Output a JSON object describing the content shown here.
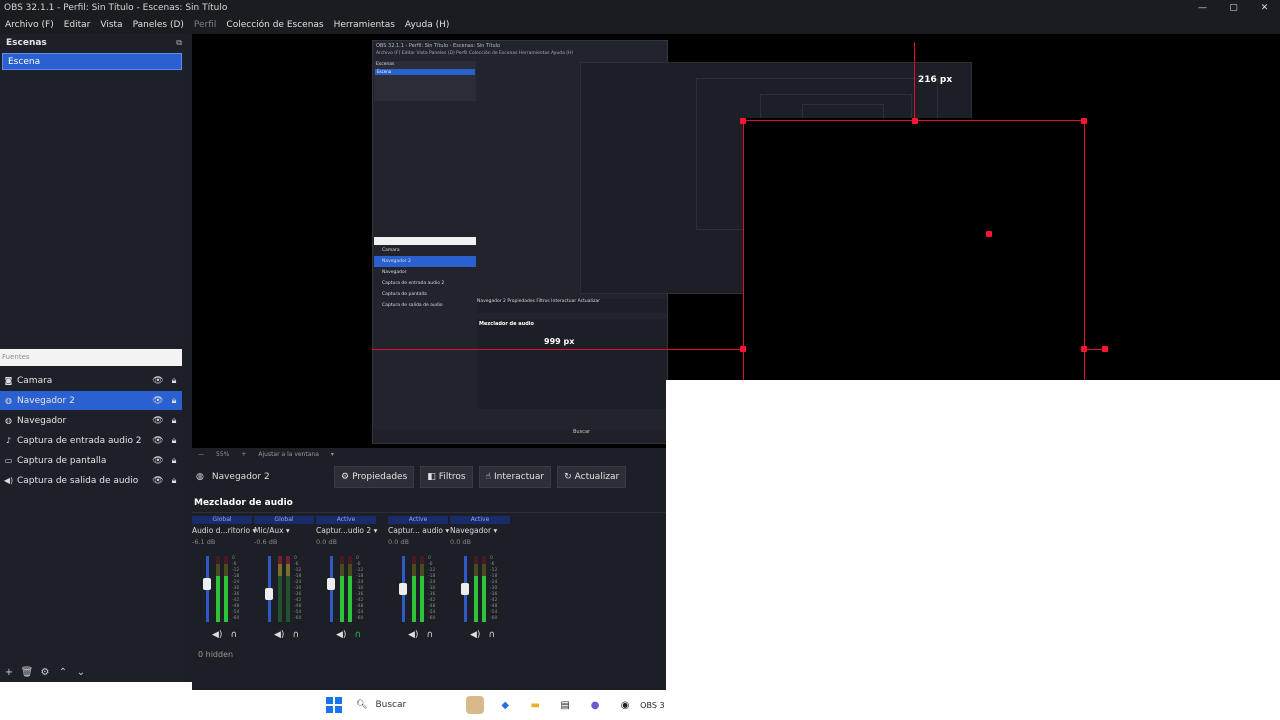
{
  "window": {
    "title": "OBS 32.1.1 - Perfil: Sin Título - Escenas: Sin Título",
    "controls": [
      "—",
      "▢",
      "✕"
    ]
  },
  "menu": [
    {
      "label": "Archivo (F)",
      "dim": false
    },
    {
      "label": "Editar",
      "dim": false
    },
    {
      "label": "Vista",
      "dim": false
    },
    {
      "label": "Paneles (D)",
      "dim": false
    },
    {
      "label": "Perfil",
      "dim": true
    },
    {
      "label": "Colección de Escenas",
      "dim": false
    },
    {
      "label": "Herramientas",
      "dim": false
    },
    {
      "label": "Ayuda (H)",
      "dim": false
    }
  ],
  "scenes": {
    "title": "Escenas",
    "items": [
      "Escena"
    ]
  },
  "sources": {
    "title": "Fuentes",
    "items": [
      {
        "label": "Camara",
        "icon": "camera-icon",
        "selected": false
      },
      {
        "label": "Navegador 2",
        "icon": "globe-icon",
        "selected": true
      },
      {
        "label": "Navegador",
        "icon": "globe-icon",
        "selected": false
      },
      {
        "label": "Captura de entrada audio 2",
        "icon": "mic-icon",
        "selected": false
      },
      {
        "label": "Captura de pantalla",
        "icon": "monitor-icon",
        "selected": false
      },
      {
        "label": "Captura de salida de audio",
        "icon": "speaker-icon",
        "selected": false
      }
    ]
  },
  "preview": {
    "label_216": "216 px",
    "label_999": "999 px",
    "inner_title": "OBS 32.1.1 - Perfil: Sin Título - Escenas: Sin Título",
    "inner_menu": "Archivo (F)   Editar   Vista   Paneles (D)   Perfil   Colección de Escenas   Herramientas   Ayuda (H)",
    "inner_scene_header": "Escenas",
    "inner_scene": "Escena",
    "inner_sources": [
      "Camara",
      "Navegador 2",
      "Navegador",
      "Captura de entrada audio 2",
      "Captura de pantalla",
      "Captura de salida de audio"
    ],
    "inner_toolbar": "Navegador 2    Propiedades   Filtros   Interactuar   Actualizar",
    "inner_mixer_title": "Mezclador de audio",
    "inner_taskbar_search": "Buscar"
  },
  "zoombar": {
    "zoom": "55%",
    "fit": "Ajustar a la ventana"
  },
  "properties_bar": {
    "source_name": "Navegador 2",
    "buttons": [
      "Propiedades",
      "Filtros",
      "Interactuar",
      "Actualizar"
    ]
  },
  "mixer": {
    "title": "Mezclador de audio",
    "channels": [
      {
        "badge": "Global",
        "name": "Audio d...ritorio",
        "db": "-6.1 dB",
        "level": 0.6,
        "active": true,
        "headphones_on": false
      },
      {
        "badge": "Global",
        "name": "Mic/Aux",
        "db": "-0.6 dB",
        "level": 0.4,
        "active": false,
        "headphones_on": false
      },
      {
        "badge": "Active",
        "name": "Captur...udio 2",
        "db": "0.0 dB",
        "level": 0.6,
        "active": true,
        "headphones_on": true
      },
      {
        "badge": "Active",
        "name": "Captur... audio",
        "db": "0.0 dB",
        "level": 0.5,
        "active": true,
        "headphones_on": false
      },
      {
        "badge": "Active",
        "name": "Navegador",
        "db": "0.0 dB",
        "level": 0.5,
        "active": true,
        "headphones_on": false
      }
    ],
    "scale": [
      "0",
      "-6",
      "-12",
      "-18",
      "-24",
      "-30",
      "-36",
      "-42",
      "-48",
      "-54",
      "-60"
    ],
    "hidden": "0 hidden"
  },
  "taskbar": {
    "search": "Buscar",
    "obs_label": "OBS 3"
  }
}
